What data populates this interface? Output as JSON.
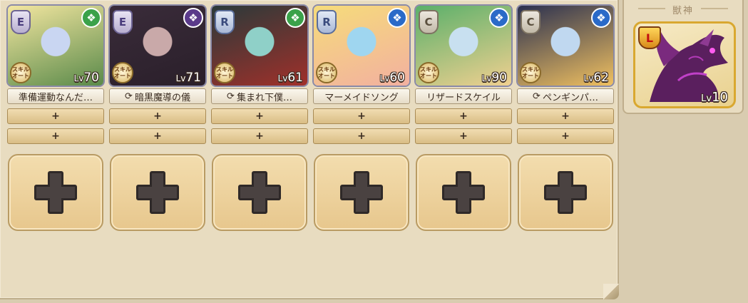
{
  "party": [
    {
      "rarity": "E",
      "element_icon": "wind-icon",
      "element_color": "#3aa24a",
      "skill_badge": "スキル\nオート",
      "level_prefix": "Lv",
      "level": "70",
      "skill_name": "準備運動なんだ…",
      "skill_has_cycle": false,
      "art_colors": [
        "#f3e6a0",
        "#c9d6f2",
        "#5a8a4a"
      ]
    },
    {
      "rarity": "E",
      "element_icon": "dark-icon",
      "element_color": "#5a3a8a",
      "skill_badge": "スキル\nオート",
      "level_prefix": "Lv",
      "level": "71",
      "skill_name": "暗黒魔導の儀",
      "skill_has_cycle": true,
      "art_colors": [
        "#3a2c3a",
        "#c9a9a9",
        "#2a1f2a"
      ]
    },
    {
      "rarity": "R",
      "element_icon": "wind-icon",
      "element_color": "#3aa24a",
      "skill_badge": "スキル\nオート",
      "level_prefix": "Lv",
      "level": "61",
      "skill_name": "集まれ下僕…",
      "skill_has_cycle": true,
      "art_colors": [
        "#2a3a3a",
        "#8fd0c8",
        "#a0302a"
      ]
    },
    {
      "rarity": "R",
      "element_icon": "water-icon",
      "element_color": "#2a6ac8",
      "skill_badge": "スキル\nオート",
      "level_prefix": "Lv",
      "level": "60",
      "skill_name": "マーメイドソング",
      "skill_has_cycle": false,
      "art_colors": [
        "#f6dc7a",
        "#9fd6f0",
        "#f2b0a0"
      ]
    },
    {
      "rarity": "C",
      "element_icon": "water-icon",
      "element_color": "#2a6ac8",
      "skill_badge": "スキル\nオート",
      "level_prefix": "Lv",
      "level": "90",
      "skill_name": "リザードスケイル",
      "skill_has_cycle": false,
      "art_colors": [
        "#5ab06a",
        "#c8e0f0",
        "#f0d090"
      ]
    },
    {
      "rarity": "C",
      "element_icon": "water-icon",
      "element_color": "#2a6ac8",
      "skill_badge": "スキル\nオート",
      "level_prefix": "Lv",
      "level": "62",
      "skill_name": "ペンギンパ…",
      "skill_has_cycle": true,
      "art_colors": [
        "#2a3050",
        "#c0d8f0",
        "#f0c060"
      ]
    }
  ],
  "empty_slot_label": "+",
  "side": {
    "title": "獣神",
    "beast_rarity": "L",
    "level_prefix": "Lv",
    "level": "10"
  }
}
